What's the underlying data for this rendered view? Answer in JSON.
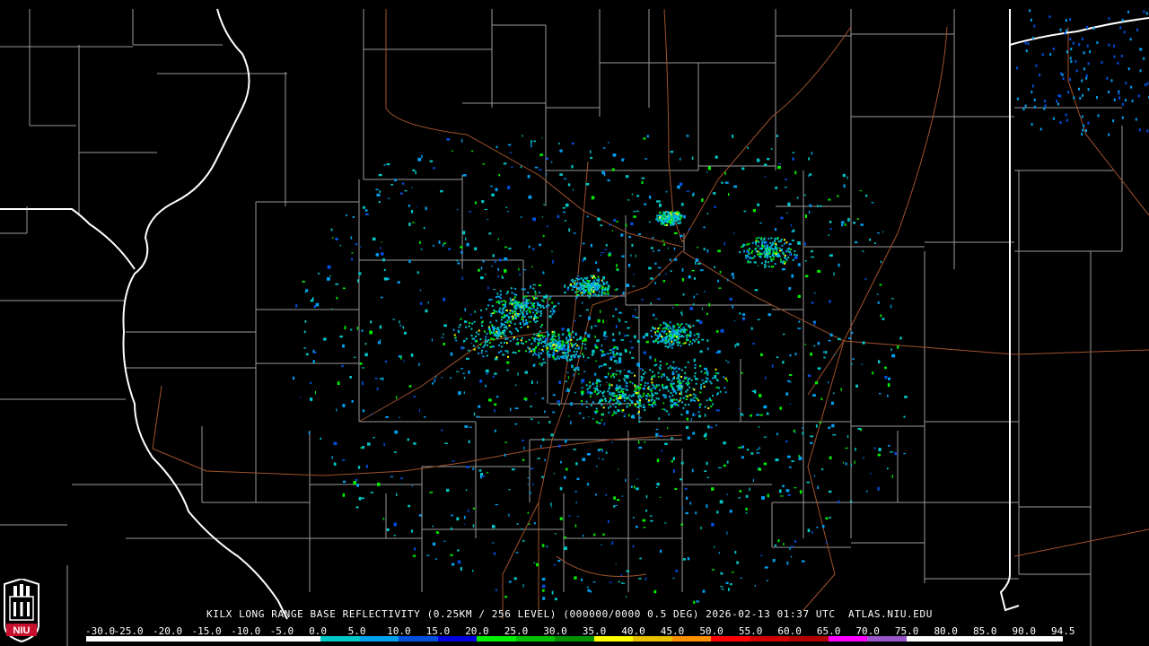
{
  "product_title": "KILX LONG RANGE BASE REFLECTIVITY (0.25KM / 256 LEVEL) (000000/0000 0.5 DEG) 2026-02-13 01:37 UTC  ATLAS.NIU.EDU",
  "logo_text": "NIU",
  "scale": {
    "labels": [
      "-30.0",
      "-25.0",
      "-20.0",
      "-15.0",
      "-10.0",
      "-5.0",
      "0.0",
      "5.0",
      "10.0",
      "15.0",
      "20.0",
      "25.0",
      "30.0",
      "35.0",
      "40.0",
      "45.0",
      "50.0",
      "55.0",
      "60.0",
      "65.0",
      "70.0",
      "75.0",
      "80.0",
      "85.0",
      "90.0",
      "94.5"
    ],
    "colors": [
      "#000000",
      "#000000",
      "#000000",
      "#000000",
      "#000000",
      "#000000",
      "#00c8c8",
      "#00a0f0",
      "#0050e0",
      "#0000e0",
      "#00f000",
      "#00c000",
      "#009000",
      "#ffff00",
      "#e8c000",
      "#ff9000",
      "#ff0000",
      "#d00000",
      "#b00000",
      "#ff00ff",
      "#9955c9",
      "#ffffff",
      "#ffffff",
      "#ffffff",
      "#ffffff"
    ]
  },
  "colors": {
    "state_border": "#ffffff",
    "county_border": "#9a9a9a",
    "highway": "#a0522d",
    "background": "#000000"
  }
}
